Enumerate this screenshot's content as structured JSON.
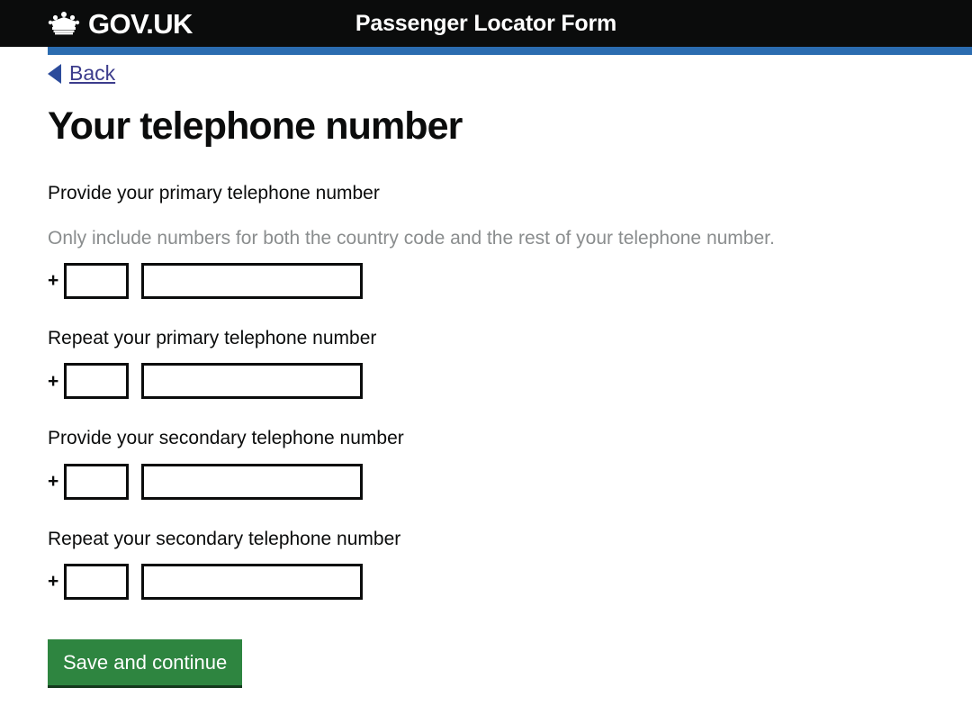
{
  "header": {
    "brand_name": "GOV.UK",
    "crown_icon": "crown-icon",
    "service_name": "Passenger Locator Form",
    "background_color": "#0b0c0c",
    "accent_bar_color": "#2b6cb0"
  },
  "back": {
    "label": "Back",
    "arrow_icon": "back-arrow-icon",
    "link_color": "#3c3c8c"
  },
  "main": {
    "page_title": "Your telephone number",
    "fields": [
      {
        "label": "Provide your primary telephone number",
        "hint": "Only include numbers for both the country code and the rest of your telephone number.",
        "prefix": "+",
        "country_code_value": "",
        "country_code_placeholder": "",
        "number_value": "",
        "number_placeholder": ""
      },
      {
        "label": "Repeat your primary telephone number",
        "hint": "",
        "prefix": "+",
        "country_code_value": "",
        "country_code_placeholder": "",
        "number_value": "",
        "number_placeholder": ""
      },
      {
        "label": "Provide your secondary telephone number",
        "hint": "",
        "prefix": "+",
        "country_code_value": "",
        "country_code_placeholder": "",
        "number_value": "",
        "number_placeholder": ""
      },
      {
        "label": "Repeat your secondary telephone number",
        "hint": "",
        "prefix": "+",
        "country_code_value": "",
        "country_code_placeholder": "",
        "number_value": "",
        "number_placeholder": ""
      }
    ],
    "submit_label": "Save and continue",
    "submit_color": "#2e8540"
  }
}
